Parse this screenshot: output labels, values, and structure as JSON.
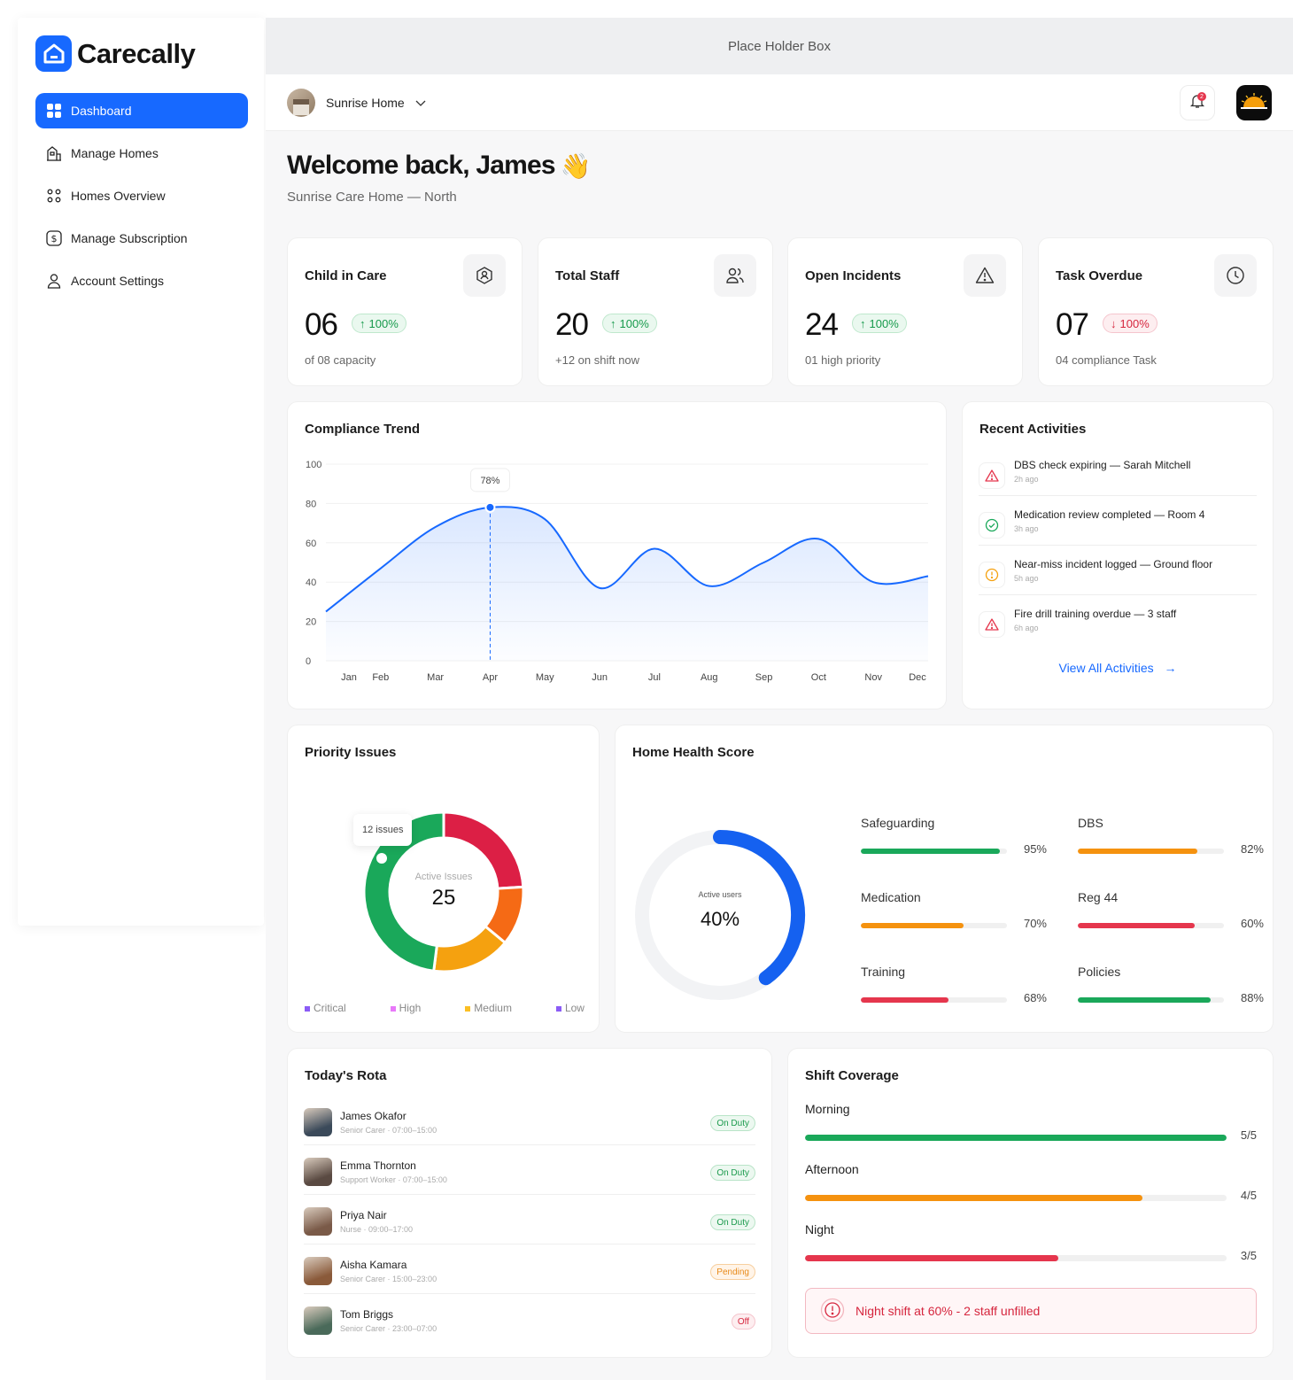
{
  "brand": {
    "name": "Carecally"
  },
  "sidebar": {
    "items": [
      {
        "label": "Dashboard",
        "icon": "grid-icon",
        "active": true
      },
      {
        "label": "Manage Homes",
        "icon": "buildings-icon"
      },
      {
        "label": "Homes Overview",
        "icon": "dots-grid-icon"
      },
      {
        "label": "Manage Subscription",
        "icon": "dollar-icon"
      },
      {
        "label": "Account Settings",
        "icon": "user-icon"
      }
    ]
  },
  "placeholder": "Place Holder Box",
  "topbar": {
    "home": "Sunrise Home",
    "notification_count": "2"
  },
  "welcome": {
    "title": "Welcome back, James",
    "subtitle": "Sunrise Care Home — North",
    "emoji": "👋"
  },
  "stats": [
    {
      "title": "Child in Care",
      "value": "06",
      "change": "100%",
      "direction": "up",
      "sub": "of 08 capacity",
      "icon": "child-icon"
    },
    {
      "title": "Total Staff",
      "value": "20",
      "change": "100%",
      "direction": "up",
      "sub": "+12 on shift now",
      "icon": "users-icon"
    },
    {
      "title": "Open Incidents",
      "value": "24",
      "change": "100%",
      "direction": "up",
      "sub": "01 high priority",
      "icon": "warning-icon"
    },
    {
      "title": "Task Overdue",
      "value": "07",
      "change": "100%",
      "direction": "down",
      "sub": "04 compliance Task",
      "icon": "clock-icon"
    }
  ],
  "compliance": {
    "title": "Compliance Trend",
    "tooltip": "78%"
  },
  "chart_data": [
    {
      "type": "area",
      "title": "Compliance Trend",
      "categories": [
        "Jan",
        "Feb",
        "Mar",
        "Apr",
        "May",
        "Jun",
        "Jul",
        "Aug",
        "Sep",
        "Oct",
        "Nov",
        "Dec"
      ],
      "values": [
        25,
        47,
        68,
        78,
        72,
        37,
        57,
        38,
        50,
        62,
        40,
        43
      ],
      "ylim": [
        0,
        100
      ],
      "yticks": [
        0,
        20,
        40,
        60,
        80,
        100
      ],
      "highlight": {
        "category": "Apr",
        "label": "78%"
      },
      "color": "#1769ff"
    },
    {
      "type": "pie",
      "title": "Priority Issues",
      "center_label": "Active Issues",
      "center_value": "25",
      "tooltip": "12 issues",
      "slices": [
        {
          "name": "Critical",
          "value": 6,
          "color": "#dc1f45"
        },
        {
          "name": "High",
          "value": 3,
          "color": "#f56a15"
        },
        {
          "name": "Medium",
          "value": 4,
          "color": "#f5a10f"
        },
        {
          "name": "Low",
          "value": 12,
          "color": "#1aa85a"
        }
      ],
      "legend": [
        {
          "name": "Critical",
          "color": "#8b5cf6"
        },
        {
          "name": "High",
          "color": "#e879f9"
        },
        {
          "name": "Medium",
          "color": "#fbbf24"
        },
        {
          "name": "Low",
          "color": "#8b5cf6"
        }
      ]
    },
    {
      "type": "pie",
      "title": "Home Health Score",
      "center_label": "Active users",
      "center_value": "40%",
      "value": 0.4,
      "color": "#1561f0"
    }
  ],
  "activities": {
    "title": "Recent Activities",
    "items": [
      {
        "text": "DBS check expiring — Sarah Mitchell",
        "time": "2h ago",
        "kind": "warning",
        "color": "#e5364d"
      },
      {
        "text": "Medication review completed — Room 4",
        "time": "3h ago",
        "kind": "check",
        "color": "#1aa85a"
      },
      {
        "text": "Near-miss incident logged — Ground floor",
        "time": "5h ago",
        "kind": "info",
        "color": "#f5a10f"
      },
      {
        "text": "Fire drill training overdue — 3 staff",
        "time": "6h ago",
        "kind": "warning",
        "color": "#e5364d"
      }
    ],
    "view_all": "View All Activities"
  },
  "priority": {
    "title": "Priority Issues"
  },
  "health": {
    "title": "Home Health Score",
    "metrics": [
      {
        "label": "Safeguarding",
        "pct": "95%",
        "value": 0.95,
        "color": "#1aa85a"
      },
      {
        "label": "DBS",
        "pct": "82%",
        "value": 0.82,
        "color": "#f5920f"
      },
      {
        "label": "Medication",
        "pct": "70%",
        "value": 0.7,
        "color": "#f5920f"
      },
      {
        "label": "Reg 44",
        "pct": "60%",
        "value": 0.8,
        "color": "#e5364d"
      },
      {
        "label": "Training",
        "pct": "68%",
        "value": 0.6,
        "color": "#e5364d"
      },
      {
        "label": "Policies",
        "pct": "88%",
        "value": 0.91,
        "color": "#1aa85a"
      }
    ]
  },
  "rota": {
    "title": "Today's Rota",
    "rows": [
      {
        "name": "James Okafor",
        "role": "Senior Carer · 07:00–15:00",
        "status": "On Duty",
        "kind": "on",
        "avatar": "#3b4a5a"
      },
      {
        "name": "Emma Thornton",
        "role": "Support Worker · 07:00–15:00",
        "status": "On Duty",
        "kind": "on",
        "avatar": "#5a4a42"
      },
      {
        "name": "Priya Nair",
        "role": "Nurse · 09:00–17:00",
        "status": "On Duty",
        "kind": "on",
        "avatar": "#7a5a48"
      },
      {
        "name": "Aisha Kamara",
        "role": "Senior Carer · 15:00–23:00",
        "status": "Pending",
        "kind": "pend",
        "avatar": "#8a5a3a"
      },
      {
        "name": "Tom Briggs",
        "role": "Senior Carer · 23:00–07:00",
        "status": "Off",
        "kind": "off",
        "avatar": "#4a6a5a"
      }
    ]
  },
  "shift": {
    "title": "Shift Coverage",
    "rows": [
      {
        "label": "Morning",
        "value": "5/5",
        "fraction": 1.0,
        "color": "#1aa85a"
      },
      {
        "label": "Afternoon",
        "value": "4/5",
        "fraction": 0.8,
        "color": "#f5920f"
      },
      {
        "label": "Night",
        "value": "3/5",
        "fraction": 0.6,
        "color": "#e5364d"
      }
    ],
    "alert": "Night shift at 60% - 2 staff unfilled"
  }
}
